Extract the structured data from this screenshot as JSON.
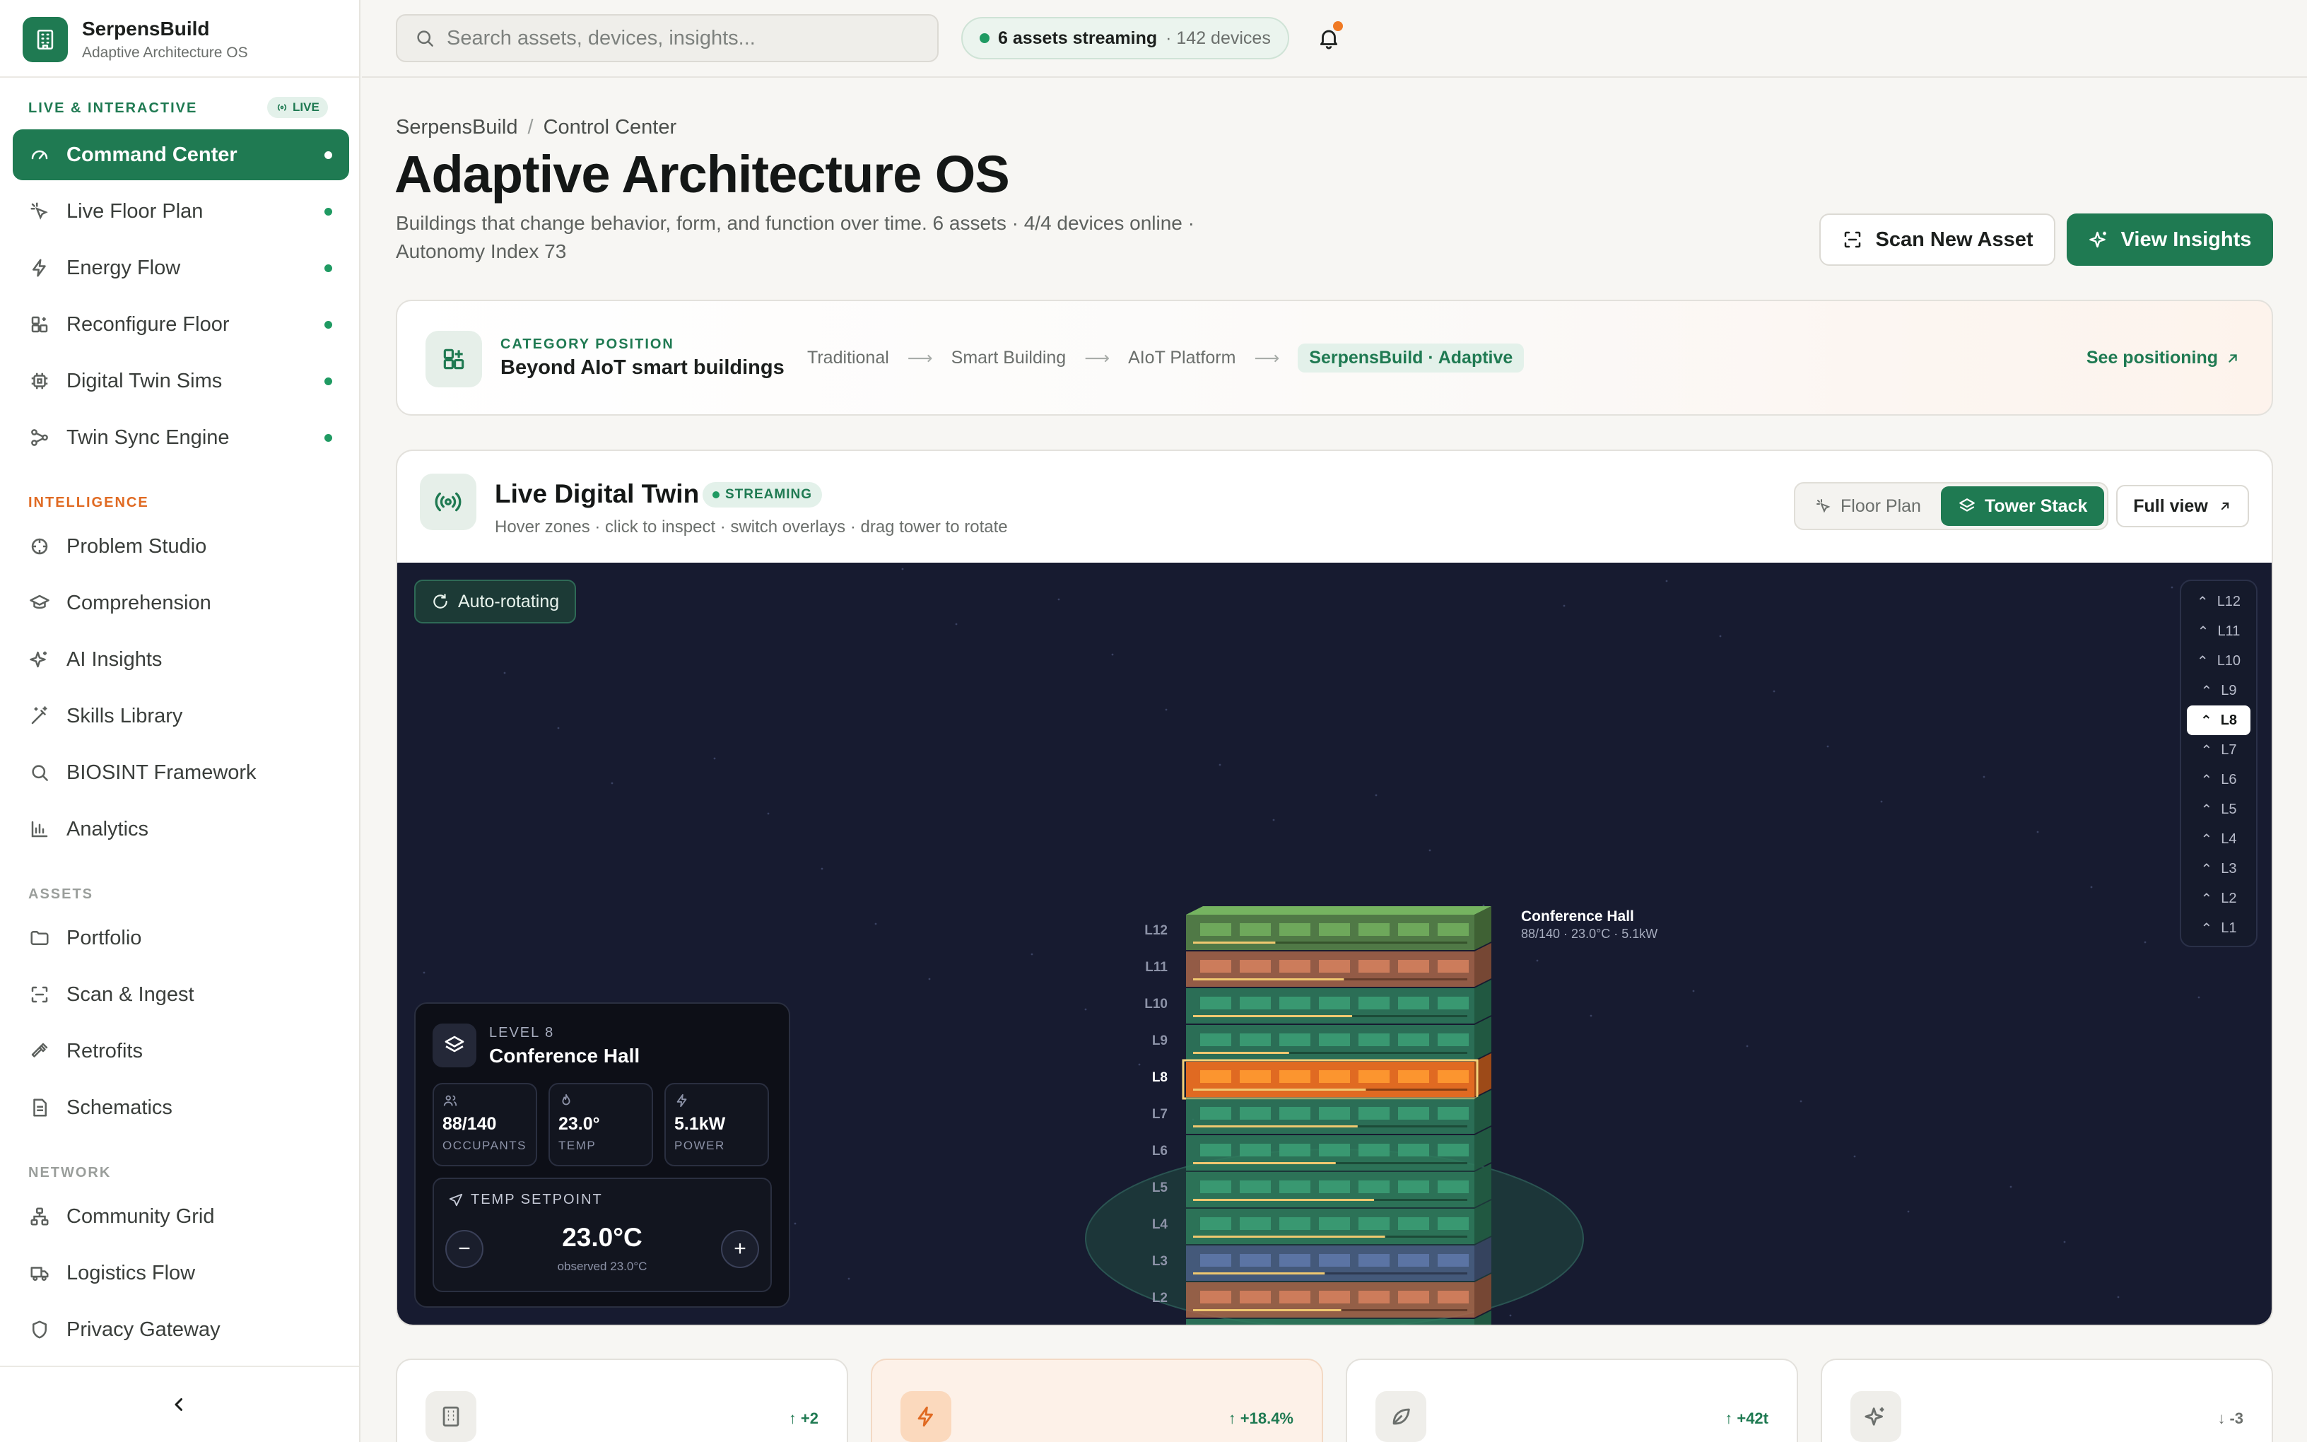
{
  "app": {
    "name": "SerpensBuild",
    "tagline": "Adaptive Architecture OS"
  },
  "sidebar": {
    "live_section": "LIVE & INTERACTIVE",
    "live_badge": "LIVE",
    "live_items": [
      {
        "label": "Command Center",
        "icon": "gauge-icon",
        "active": true
      },
      {
        "label": "Live Floor Plan",
        "icon": "sparkle-pointer-icon"
      },
      {
        "label": "Energy Flow",
        "icon": "lightning-icon"
      },
      {
        "label": "Reconfigure Floor",
        "icon": "grid-reconfigure-icon"
      },
      {
        "label": "Digital Twin Sims",
        "icon": "chip-icon"
      },
      {
        "label": "Twin Sync Engine",
        "icon": "nodes-icon"
      }
    ],
    "intelligence_section": "INTELLIGENCE",
    "intelligence_items": [
      {
        "label": "Problem Studio",
        "icon": "target-icon"
      },
      {
        "label": "Comprehension",
        "icon": "graduation-cap-icon"
      },
      {
        "label": "AI Insights",
        "icon": "sparkles-icon"
      },
      {
        "label": "Skills Library",
        "icon": "wand-icon"
      },
      {
        "label": "BIOSINT Framework",
        "icon": "search-icon"
      },
      {
        "label": "Analytics",
        "icon": "bar-chart-icon"
      }
    ],
    "assets_section": "ASSETS",
    "assets_items": [
      {
        "label": "Portfolio",
        "icon": "folder-icon"
      },
      {
        "label": "Scan & Ingest",
        "icon": "scan-icon"
      },
      {
        "label": "Retrofits",
        "icon": "hammer-icon"
      },
      {
        "label": "Schematics",
        "icon": "document-icon"
      }
    ],
    "network_section": "NETWORK",
    "network_items": [
      {
        "label": "Community Grid",
        "icon": "network-icon"
      },
      {
        "label": "Logistics Flow",
        "icon": "truck-icon"
      },
      {
        "label": "Privacy Gateway",
        "icon": "shield-icon"
      }
    ]
  },
  "topbar": {
    "search_placeholder": "Search assets, devices, insights...",
    "stream_main": "6 assets streaming",
    "stream_sub": "· 142 devices"
  },
  "page": {
    "breadcrumb": [
      "SerpensBuild",
      "Control Center"
    ],
    "title": "Adaptive Architecture OS",
    "subtitle": "Buildings that change behavior, form, and function over time. 6 assets · 4/4 devices online · Autonomy Index 73",
    "scan_button": "Scan New Asset",
    "insights_button": "View Insights"
  },
  "category": {
    "label": "CATEGORY POSITION",
    "value": "Beyond AIoT smart buildings",
    "steps": [
      "Traditional",
      "Smart Building",
      "AIoT Platform",
      "SerpensBuild · Adaptive"
    ],
    "link": "See positioning"
  },
  "twin": {
    "title": "Live Digital Twin",
    "badge": "STREAMING",
    "help": "Hover zones · click to inspect · switch overlays · drag tower to rotate",
    "view_floor": "Floor Plan",
    "view_tower": "Tower Stack",
    "full_view": "Full view",
    "auto_rotate": "Auto-rotating",
    "levels": [
      "L12",
      "L11",
      "L10",
      "L9",
      "L8",
      "L7",
      "L6",
      "L5",
      "L4",
      "L3",
      "L2",
      "L1"
    ],
    "selected_level": "L8",
    "level_colors": {
      "L12": "#5a8a4a",
      "L11": "#a9664a",
      "L10": "#2f7d5d",
      "L9": "#2f7d5d",
      "L8": "#e06a22",
      "L7": "#2f7d5d",
      "L6": "#2f7d5d",
      "L5": "#2f7d5d",
      "L4": "#2f7d5d",
      "L3": "#4b5f86",
      "L2": "#a9664a",
      "L1": "#2f7d5d"
    },
    "level_load": {
      "L12": 0.3,
      "L11": 0.55,
      "L10": 0.58,
      "L9": 0.35,
      "L8": 0.63,
      "L7": 0.6,
      "L6": 0.52,
      "L5": 0.66,
      "L4": 0.7,
      "L3": 0.48,
      "L2": 0.54,
      "L1": 0.35
    },
    "callout_title": "Conference Hall",
    "callout_sub": "88/140 · 23.0°C · 5.1kW",
    "inspector": {
      "level_label": "LEVEL 8",
      "zone": "Conference Hall",
      "occupants_value": "88/140",
      "occupants_label": "OCCUPANTS",
      "temp_value": "23.0°",
      "temp_label": "TEMP",
      "power_value": "5.1kW",
      "power_label": "POWER",
      "setpoint_label": "TEMP SETPOINT",
      "setpoint_value": "23.0°C",
      "observed": "observed 23.0°C"
    }
  },
  "cards": [
    {
      "icon": "building-icon",
      "delta": "+2",
      "dir": "up"
    },
    {
      "icon": "lightning-icon",
      "delta": "+18.4%",
      "dir": "up"
    },
    {
      "icon": "leaf-icon",
      "delta": "+42t",
      "dir": "up"
    },
    {
      "icon": "sparkles-icon",
      "delta": "-3",
      "dir": "down"
    }
  ]
}
